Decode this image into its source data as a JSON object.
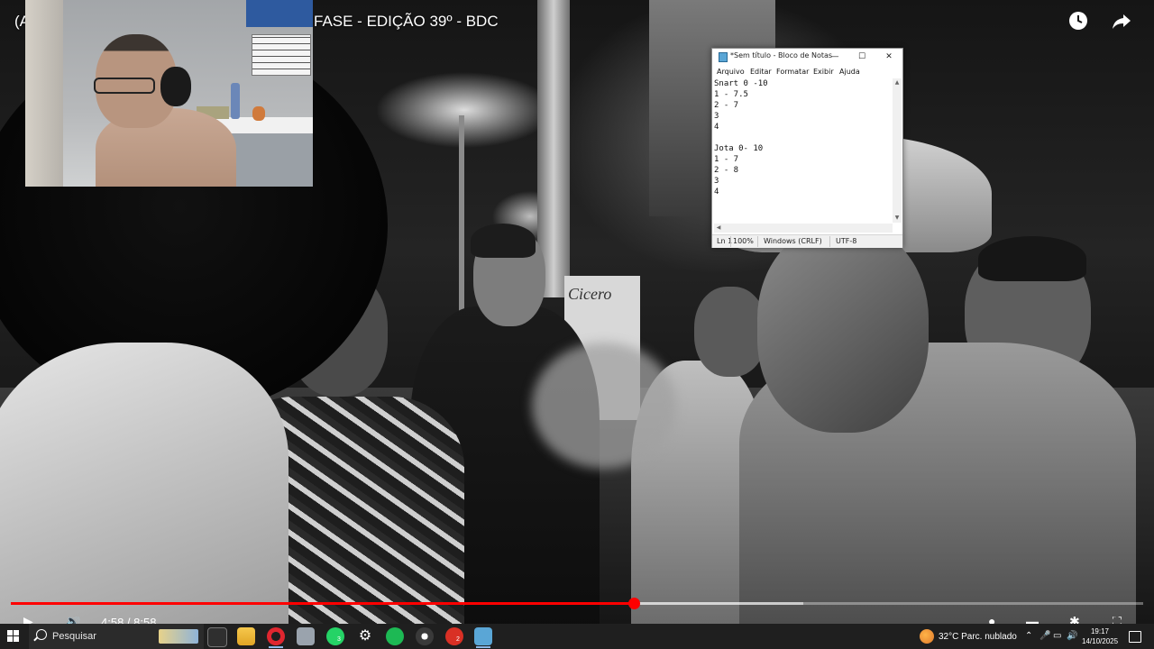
{
  "video": {
    "title_left": "(A",
    "title_right": "FASE - EDIÇÃO 39º - BDC",
    "sign_text": "Cicero",
    "icons": {
      "clock": "clock-icon",
      "share": "share-icon"
    }
  },
  "webcam": {
    "overlay": "streamer-webcam"
  },
  "notepad": {
    "title": "*Sem título - Bloco de Notas",
    "controls": {
      "minimize": "—",
      "maximize": "☐",
      "close": "✕"
    },
    "menu": [
      "Arquivo",
      "Editar",
      "Formatar",
      "Exibir",
      "Ajuda"
    ],
    "lines": [
      "Snart 0 -10",
      "1 - 7.5",
      "2 - 7",
      "3",
      "4",
      "",
      "Jota 0- 10",
      "1 - 7",
      "2 - 8",
      "3",
      "4"
    ],
    "status": {
      "position": "Ln 1",
      "zoom": "100%",
      "line_ending": "Windows (CRLF)",
      "encoding": "UTF-8"
    }
  },
  "player": {
    "progress_fraction": 0.55,
    "buffered_fraction": 0.7,
    "time_text": "4:58 / 8:58",
    "colors": {
      "played": "#ff0000"
    }
  },
  "taskbar": {
    "search_placeholder": "Pesquisar",
    "apps": [
      {
        "name": "task-view-icon",
        "badge": ""
      },
      {
        "name": "file-explorer-icon",
        "badge": ""
      },
      {
        "name": "opera-icon",
        "badge": ""
      },
      {
        "name": "app-icon",
        "badge": ""
      },
      {
        "name": "whatsapp-icon",
        "badge": "3"
      },
      {
        "name": "settings-icon",
        "badge": ""
      },
      {
        "name": "spotify-icon",
        "badge": ""
      },
      {
        "name": "obs-icon",
        "badge": ""
      },
      {
        "name": "browser-icon",
        "badge": "2"
      },
      {
        "name": "notepad-icon",
        "badge": ""
      }
    ],
    "weather": "32°C  Parc. nublado",
    "clock_time": "19:17",
    "clock_date": "14/10/2025"
  }
}
